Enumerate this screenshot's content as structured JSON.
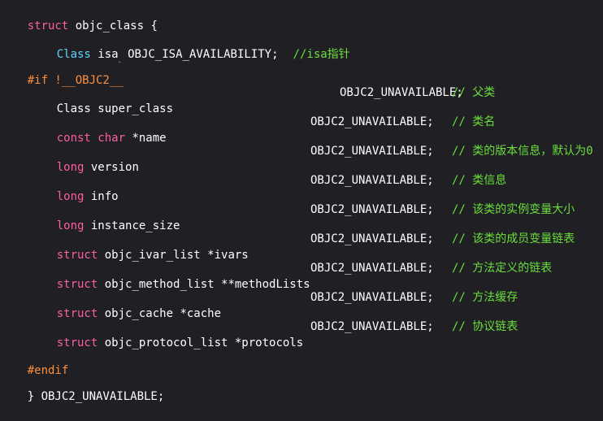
{
  "code": {
    "l1": {
      "kw": "struct",
      "rest": " objc_class {"
    },
    "l2": {
      "type": "Class",
      "name": " isa",
      "macro": " OBJC_ISA_AVAILABILITY;",
      "comment": "//isa指针"
    },
    "l3": {
      "directive": "#if !__OBJC2__"
    },
    "fields": [
      {
        "kw": "",
        "type": "Class super_class",
        "attr": "OBJC2_UNAVAILABLE;",
        "comment": "// 父类"
      },
      {
        "kw": "const char",
        "type": " *name",
        "attr": "OBJC2_UNAVAILABLE;",
        "comment": "// 类名"
      },
      {
        "kw": "long",
        "type": " version",
        "attr": "OBJC2_UNAVAILABLE;",
        "comment": "// 类的版本信息，默认为0"
      },
      {
        "kw": "long",
        "type": " info",
        "attr": "OBJC2_UNAVAILABLE;",
        "comment": "// 类信息"
      },
      {
        "kw": "long",
        "type": " instance_size",
        "attr": "OBJC2_UNAVAILABLE;",
        "comment": "// 该类的实例变量大小"
      },
      {
        "kw": "struct",
        "type": " objc_ivar_list *ivars",
        "attr": "OBJC2_UNAVAILABLE;",
        "comment": "// 该类的成员变量链表"
      },
      {
        "kw": "struct",
        "type": " objc_method_list **methodLists",
        "attr": "OBJC2_UNAVAILABLE;",
        "comment": "// 方法定义的链表"
      },
      {
        "kw": "struct",
        "type": " objc_cache *cache",
        "attr": "OBJC2_UNAVAILABLE;",
        "comment": "// 方法缓存"
      },
      {
        "kw": "struct",
        "type": " objc_protocol_list *protocols",
        "attr": "OBJC2_UNAVAILABLE;",
        "comment": "// 协议链表"
      }
    ],
    "l13": {
      "directive": "#endif"
    },
    "l14": {
      "rest": "} OBJC2_UNAVAILABLE;"
    }
  },
  "colors": {
    "background": "#1f1f24",
    "keyword": "#fc5fa3",
    "preprocessor": "#fd8f3f",
    "type": "#5dd8ff",
    "comment": "#6bdf3c",
    "text": "#ffffff"
  }
}
